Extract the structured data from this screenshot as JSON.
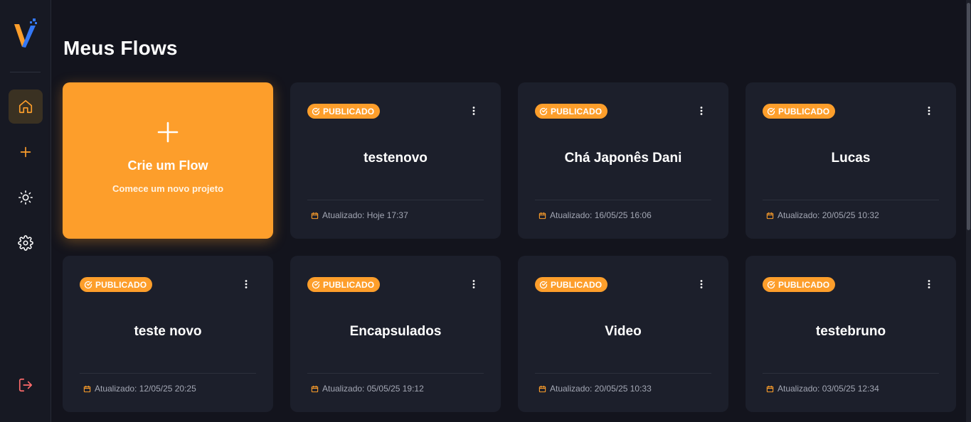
{
  "sidebar": {
    "items": [
      {
        "name": "home",
        "icon": "home-icon",
        "active": true
      },
      {
        "name": "add",
        "icon": "plus-icon",
        "active": false
      },
      {
        "name": "theme",
        "icon": "sun-icon",
        "active": false
      },
      {
        "name": "settings",
        "icon": "gear-icon",
        "active": false
      },
      {
        "name": "logout",
        "icon": "logout-icon",
        "active": false
      }
    ]
  },
  "page": {
    "title": "Meus Flows"
  },
  "create_card": {
    "title": "Crie um Flow",
    "subtitle": "Comece um novo projeto"
  },
  "flows": [
    {
      "status": "PUBLICADO",
      "name": "testenovo",
      "updated": "Atualizado: Hoje 17:37"
    },
    {
      "status": "PUBLICADO",
      "name": "Chá Japonês Dani",
      "updated": "Atualizado: 16/05/25 16:06"
    },
    {
      "status": "PUBLICADO",
      "name": "Lucas",
      "updated": "Atualizado: 20/05/25 10:32"
    },
    {
      "status": "PUBLICADO",
      "name": "teste novo",
      "updated": "Atualizado: 12/05/25 20:25"
    },
    {
      "status": "PUBLICADO",
      "name": "Encapsulados",
      "updated": "Atualizado: 05/05/25 19:12"
    },
    {
      "status": "PUBLICADO",
      "name": "Video",
      "updated": "Atualizado: 20/05/25 10:33"
    },
    {
      "status": "PUBLICADO",
      "name": "testebruno",
      "updated": "Atualizado: 03/05/25 12:34"
    }
  ],
  "colors": {
    "accent": "#fd9e2b",
    "background": "#13141d",
    "card": "#1c1f2b",
    "logout": "#ff6b6b",
    "logo_blue": "#3478f6"
  }
}
